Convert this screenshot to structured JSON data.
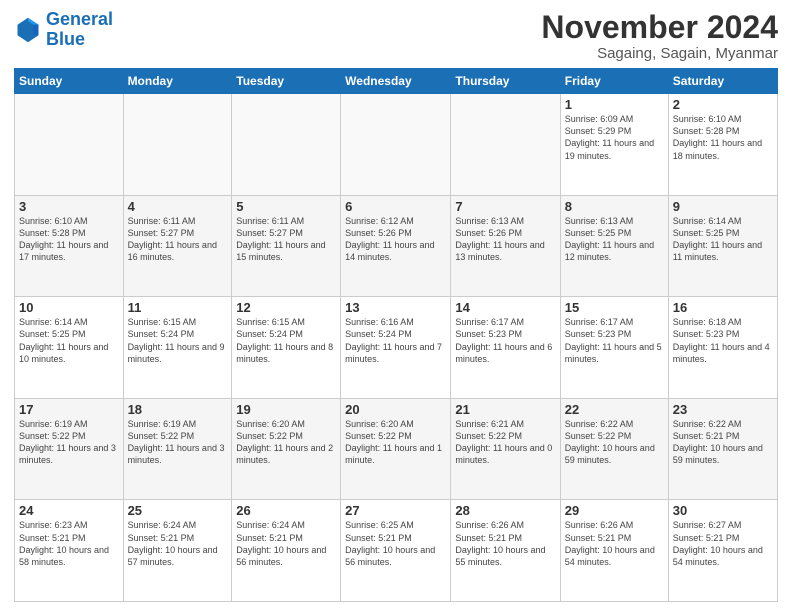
{
  "logo": {
    "line1": "General",
    "line2": "Blue"
  },
  "title": "November 2024",
  "subtitle": "Sagaing, Sagain, Myanmar",
  "headers": [
    "Sunday",
    "Monday",
    "Tuesday",
    "Wednesday",
    "Thursday",
    "Friday",
    "Saturday"
  ],
  "weeks": [
    [
      {
        "day": "",
        "info": ""
      },
      {
        "day": "",
        "info": ""
      },
      {
        "day": "",
        "info": ""
      },
      {
        "day": "",
        "info": ""
      },
      {
        "day": "",
        "info": ""
      },
      {
        "day": "1",
        "info": "Sunrise: 6:09 AM\nSunset: 5:29 PM\nDaylight: 11 hours and 19 minutes."
      },
      {
        "day": "2",
        "info": "Sunrise: 6:10 AM\nSunset: 5:28 PM\nDaylight: 11 hours and 18 minutes."
      }
    ],
    [
      {
        "day": "3",
        "info": "Sunrise: 6:10 AM\nSunset: 5:28 PM\nDaylight: 11 hours and 17 minutes."
      },
      {
        "day": "4",
        "info": "Sunrise: 6:11 AM\nSunset: 5:27 PM\nDaylight: 11 hours and 16 minutes."
      },
      {
        "day": "5",
        "info": "Sunrise: 6:11 AM\nSunset: 5:27 PM\nDaylight: 11 hours and 15 minutes."
      },
      {
        "day": "6",
        "info": "Sunrise: 6:12 AM\nSunset: 5:26 PM\nDaylight: 11 hours and 14 minutes."
      },
      {
        "day": "7",
        "info": "Sunrise: 6:13 AM\nSunset: 5:26 PM\nDaylight: 11 hours and 13 minutes."
      },
      {
        "day": "8",
        "info": "Sunrise: 6:13 AM\nSunset: 5:25 PM\nDaylight: 11 hours and 12 minutes."
      },
      {
        "day": "9",
        "info": "Sunrise: 6:14 AM\nSunset: 5:25 PM\nDaylight: 11 hours and 11 minutes."
      }
    ],
    [
      {
        "day": "10",
        "info": "Sunrise: 6:14 AM\nSunset: 5:25 PM\nDaylight: 11 hours and 10 minutes."
      },
      {
        "day": "11",
        "info": "Sunrise: 6:15 AM\nSunset: 5:24 PM\nDaylight: 11 hours and 9 minutes."
      },
      {
        "day": "12",
        "info": "Sunrise: 6:15 AM\nSunset: 5:24 PM\nDaylight: 11 hours and 8 minutes."
      },
      {
        "day": "13",
        "info": "Sunrise: 6:16 AM\nSunset: 5:24 PM\nDaylight: 11 hours and 7 minutes."
      },
      {
        "day": "14",
        "info": "Sunrise: 6:17 AM\nSunset: 5:23 PM\nDaylight: 11 hours and 6 minutes."
      },
      {
        "day": "15",
        "info": "Sunrise: 6:17 AM\nSunset: 5:23 PM\nDaylight: 11 hours and 5 minutes."
      },
      {
        "day": "16",
        "info": "Sunrise: 6:18 AM\nSunset: 5:23 PM\nDaylight: 11 hours and 4 minutes."
      }
    ],
    [
      {
        "day": "17",
        "info": "Sunrise: 6:19 AM\nSunset: 5:22 PM\nDaylight: 11 hours and 3 minutes."
      },
      {
        "day": "18",
        "info": "Sunrise: 6:19 AM\nSunset: 5:22 PM\nDaylight: 11 hours and 3 minutes."
      },
      {
        "day": "19",
        "info": "Sunrise: 6:20 AM\nSunset: 5:22 PM\nDaylight: 11 hours and 2 minutes."
      },
      {
        "day": "20",
        "info": "Sunrise: 6:20 AM\nSunset: 5:22 PM\nDaylight: 11 hours and 1 minute."
      },
      {
        "day": "21",
        "info": "Sunrise: 6:21 AM\nSunset: 5:22 PM\nDaylight: 11 hours and 0 minutes."
      },
      {
        "day": "22",
        "info": "Sunrise: 6:22 AM\nSunset: 5:22 PM\nDaylight: 10 hours and 59 minutes."
      },
      {
        "day": "23",
        "info": "Sunrise: 6:22 AM\nSunset: 5:21 PM\nDaylight: 10 hours and 59 minutes."
      }
    ],
    [
      {
        "day": "24",
        "info": "Sunrise: 6:23 AM\nSunset: 5:21 PM\nDaylight: 10 hours and 58 minutes."
      },
      {
        "day": "25",
        "info": "Sunrise: 6:24 AM\nSunset: 5:21 PM\nDaylight: 10 hours and 57 minutes."
      },
      {
        "day": "26",
        "info": "Sunrise: 6:24 AM\nSunset: 5:21 PM\nDaylight: 10 hours and 56 minutes."
      },
      {
        "day": "27",
        "info": "Sunrise: 6:25 AM\nSunset: 5:21 PM\nDaylight: 10 hours and 56 minutes."
      },
      {
        "day": "28",
        "info": "Sunrise: 6:26 AM\nSunset: 5:21 PM\nDaylight: 10 hours and 55 minutes."
      },
      {
        "day": "29",
        "info": "Sunrise: 6:26 AM\nSunset: 5:21 PM\nDaylight: 10 hours and 54 minutes."
      },
      {
        "day": "30",
        "info": "Sunrise: 6:27 AM\nSunset: 5:21 PM\nDaylight: 10 hours and 54 minutes."
      }
    ]
  ]
}
